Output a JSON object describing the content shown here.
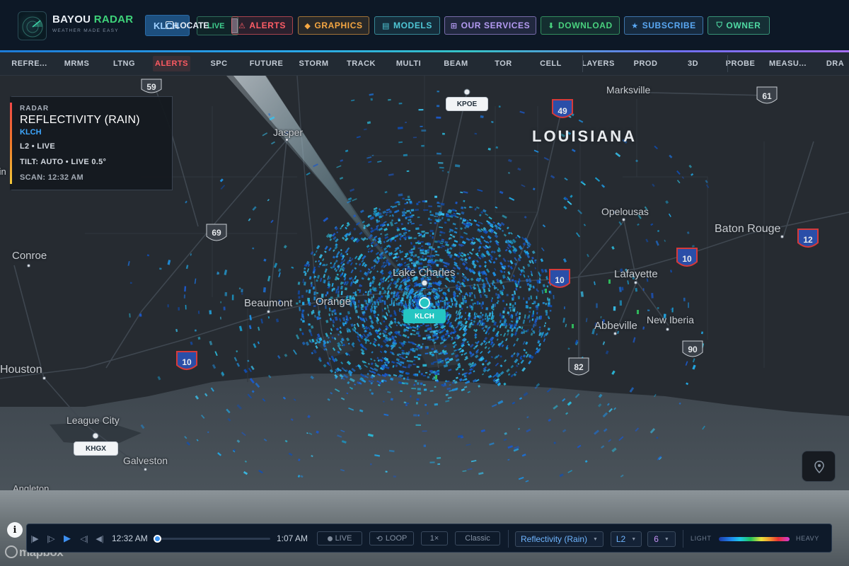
{
  "header": {
    "brand_part1": "BAYOU",
    "brand_part2": "RADAR",
    "tagline": "WEATHER MADE EASY",
    "station": "KLCH",
    "locate": "LOCATE",
    "live": "LIVE",
    "buttons": [
      {
        "label": "ALERTS",
        "icon": "warning-icon",
        "glyph": "⚠",
        "color": "#ff5d66"
      },
      {
        "label": "GRAPHICS",
        "icon": "diamond-icon",
        "glyph": "◆",
        "color": "#f5a742"
      },
      {
        "label": "MODELS",
        "icon": "grid-icon",
        "glyph": "▤",
        "color": "#4fc7d6"
      },
      {
        "label": "OUR SERVICES",
        "icon": "apps-icon",
        "glyph": "⊞",
        "color": "#b49bf3"
      },
      {
        "label": "DOWNLOAD",
        "icon": "download-icon",
        "glyph": "⬇",
        "color": "#49d17e"
      },
      {
        "label": "SUBSCRIBE",
        "icon": "star-icon",
        "glyph": "★",
        "color": "#5aa9f5"
      },
      {
        "label": "OWNER",
        "icon": "shield-icon",
        "glyph": "⛉",
        "color": "#4fd9a3"
      }
    ]
  },
  "nav": {
    "items": [
      "REFRE...",
      "MRMS",
      "LTNG",
      "ALERTS",
      "SPC",
      "FUTURE",
      "STORM",
      "TRACK",
      "MULTI",
      "BEAM",
      "TOR",
      "CELL",
      "LAYERS",
      "PROD",
      "3D",
      "PROBE",
      "MEASU...",
      "DRA"
    ],
    "active": "ALERTS"
  },
  "map": {
    "state_label": "LOUISIANA",
    "cities": [
      "Marksville",
      "Jasper",
      "Opelousas",
      "Baton Rouge",
      "Conroe",
      "Lake Charles",
      "Lafayette",
      "Beaumont",
      "Orange",
      "Abbeville",
      "New Iberia",
      "Houston",
      "League City",
      "Galveston",
      "Angleton",
      "Lufkin"
    ],
    "shields": [
      "59",
      "61",
      "49",
      "69",
      "10",
      "10",
      "12",
      "10",
      "90",
      "82"
    ],
    "stations": [
      "KPOE",
      "KLCH",
      "KHGX"
    ]
  },
  "info_panel": {
    "kicker": "RADAR",
    "title": "REFLECTIVITY (RAIN)",
    "station": "KLCH",
    "level": "L2 • LIVE",
    "tilt": "TILT: AUTO • LIVE 0.5°",
    "scan": "SCAN: 12:32 AM"
  },
  "player": {
    "start_time": "12:32 AM",
    "end_time": "1:07 AM",
    "progress": 0.0,
    "live": "LIVE",
    "loop": "LOOP",
    "speed": "1×",
    "style": "Classic",
    "product": "Reflectivity (Rain)",
    "level": "L2",
    "tilt": "6",
    "legend_light": "LIGHT",
    "legend_heavy": "HEAVY"
  },
  "attribution": {
    "mapbox": "mapbox",
    "info": "i"
  },
  "colors": {
    "accent": "#3d8ff0",
    "radar_teal": "#25c6c2",
    "nav_active": "#ff5a62"
  }
}
